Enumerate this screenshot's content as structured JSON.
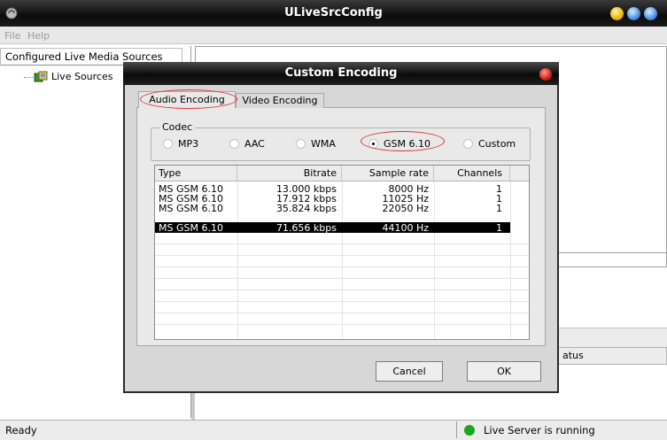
{
  "main_window": {
    "title": "ULiveSrcConfig",
    "menu": [
      "File",
      "Help"
    ],
    "left_pane_header": "Configured Live Media Sources",
    "tree_root": "Live Sources",
    "right_bottom_header_partial": "atus"
  },
  "dialog": {
    "title": "Custom Encoding",
    "tabs": [
      {
        "label": "Audio Encoding",
        "active": true,
        "highlighted": true
      },
      {
        "label": "Video Encoding",
        "active": false
      }
    ],
    "codec_group_label": "Codec",
    "codecs": [
      {
        "label": "MP3",
        "selected": false
      },
      {
        "label": "AAC",
        "selected": false
      },
      {
        "label": "WMA",
        "selected": false
      },
      {
        "label": "GSM 6.10",
        "selected": true,
        "highlighted": true
      },
      {
        "label": "Custom",
        "selected": false
      }
    ],
    "table": {
      "columns": [
        "Type",
        "Bitrate",
        "Sample rate",
        "Channels"
      ],
      "rows": [
        {
          "type": "MS GSM 6.10",
          "bitrate": "13.000 kbps",
          "sample_rate": "8000 Hz",
          "channels": "1",
          "selected": false
        },
        {
          "type": "MS GSM 6.10",
          "bitrate": "17.912 kbps",
          "sample_rate": "11025 Hz",
          "channels": "1",
          "selected": false
        },
        {
          "type": "MS GSM 6.10",
          "bitrate": "35.824 kbps",
          "sample_rate": "22050 Hz",
          "channels": "1",
          "selected": false
        },
        {
          "type": "MS GSM 6.10",
          "bitrate": "71.656 kbps",
          "sample_rate": "44100 Hz",
          "channels": "1",
          "selected": true
        }
      ]
    },
    "buttons": {
      "cancel": "Cancel",
      "ok": "OK"
    }
  },
  "statusbar": {
    "left": "Ready",
    "server_status": "Live Server is running",
    "server_status_color": "#1ea31e"
  },
  "colors": {
    "titlebar": "#0c0c0c",
    "highlight_ellipse": "#d33333",
    "selection": "#000000"
  }
}
